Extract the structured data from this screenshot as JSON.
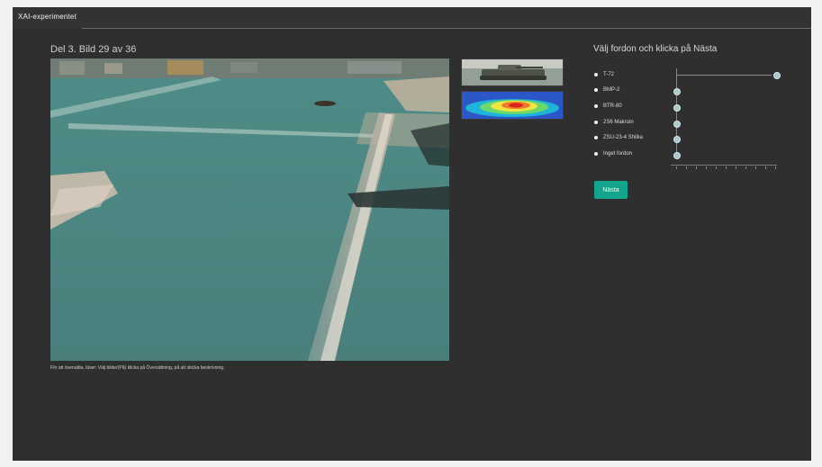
{
  "app": {
    "title": "XAI-experimentet"
  },
  "header": {
    "progress": "Del 3. Bild 29 av 36"
  },
  "caption": "För att översätta, läser: Välj bilder(På) klicka på Översättning, på att skicka beskrivning.",
  "panel": {
    "title": "Välj fordon och klicka på Nästa",
    "options": [
      {
        "label": "T-72"
      },
      {
        "label": "BMP-2"
      },
      {
        "label": "BTR-80"
      },
      {
        "label": "2S6 Makroin"
      },
      {
        "label": "ZSU-23-4 Shilka"
      },
      {
        "label": "Inget fordon"
      }
    ],
    "confidence_level": 1.0,
    "next_label": "Nästa"
  },
  "colors": {
    "app_bg": "#2f2f2f",
    "accent": "#12a58c"
  }
}
